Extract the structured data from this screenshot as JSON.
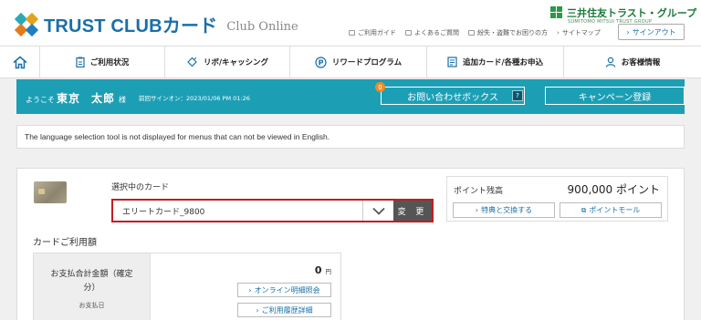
{
  "header": {
    "logo_text": "TRUST CLUBカード",
    "logo_sub": "Club Online",
    "brand_text": "三井住友トラスト・グループ",
    "brand_sub": "SUMITOMO MITSUI TRUST GROUP",
    "util_links": [
      {
        "label": "ご利用ガイド",
        "icon": "guide-icon"
      },
      {
        "label": "よくあるご質問",
        "icon": "faq-icon"
      },
      {
        "label": "紛失・盗難でお困りの方",
        "icon": "lost-card-icon"
      },
      {
        "label": "サイトマップ",
        "icon": "chevron-right-icon"
      }
    ],
    "signout_label": "サインアウト"
  },
  "nav": {
    "home_icon": "home-icon",
    "items": [
      {
        "label": "ご利用状況",
        "icon": "clipboard-icon"
      },
      {
        "label": "リボ/キャッシング",
        "icon": "revolving-icon"
      },
      {
        "label": "リワードプログラム",
        "icon": "points-icon"
      },
      {
        "label": "追加カード/各種お申込",
        "icon": "application-icon"
      },
      {
        "label": "お客様情報",
        "icon": "user-icon"
      }
    ]
  },
  "banner": {
    "welcome_prefix": "ようこそ",
    "last_name": "東京",
    "first_name": "太郎",
    "honorific": "様",
    "last_signin": "前回サインオン：2023/01/06 PM 01:26",
    "inquiry_label": "お問い合わせボックス",
    "inquiry_badge": "0",
    "help_label": "?",
    "campaign_label": "キャンペーン登録"
  },
  "info_message": "The language selection tool is not displayed for menus that can not be viewed in English.",
  "card_section": {
    "select_label": "選択中のカード",
    "selected_card": "エリートカード_9800",
    "change_label": "変 更",
    "points_label": "ポイント残高",
    "points_value": "900,000 ポイント",
    "exchange_label": "特典と交換する",
    "mall_label": "ポイントモール",
    "usage_title": "カードご利用額",
    "total_label": "お支払合計金額（確定分）",
    "payment_date_label": "お支払日",
    "amount": "0",
    "amount_unit": "円",
    "online_detail_label": "オンライン明細照会",
    "history_label": "ご利用履歴詳細"
  }
}
